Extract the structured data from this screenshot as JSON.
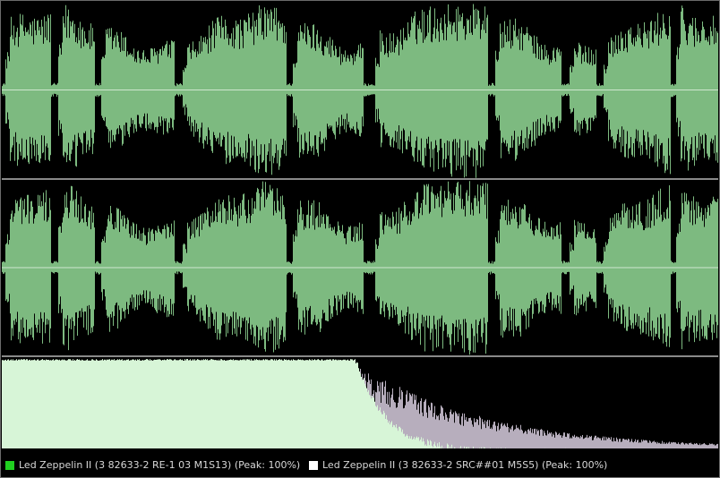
{
  "colors": {
    "background": "#000000",
    "waveform": "#7dba80",
    "waveform_edge": "#9fd8a2",
    "center_line": "#cfe7cf",
    "spectrum_a": "#d7f5d7",
    "spectrum_b": "#b7aebd"
  },
  "legend": {
    "items": [
      {
        "label": "Led Zeppelin II (3 82633-2 RE-1 03 M1S13) (Peak: 100%)",
        "color": "#20d020"
      },
      {
        "label": "Led Zeppelin II (3 82633-2 SRC##01 M5S5) (Peak: 100%)",
        "color": "#ffffff"
      }
    ]
  }
}
